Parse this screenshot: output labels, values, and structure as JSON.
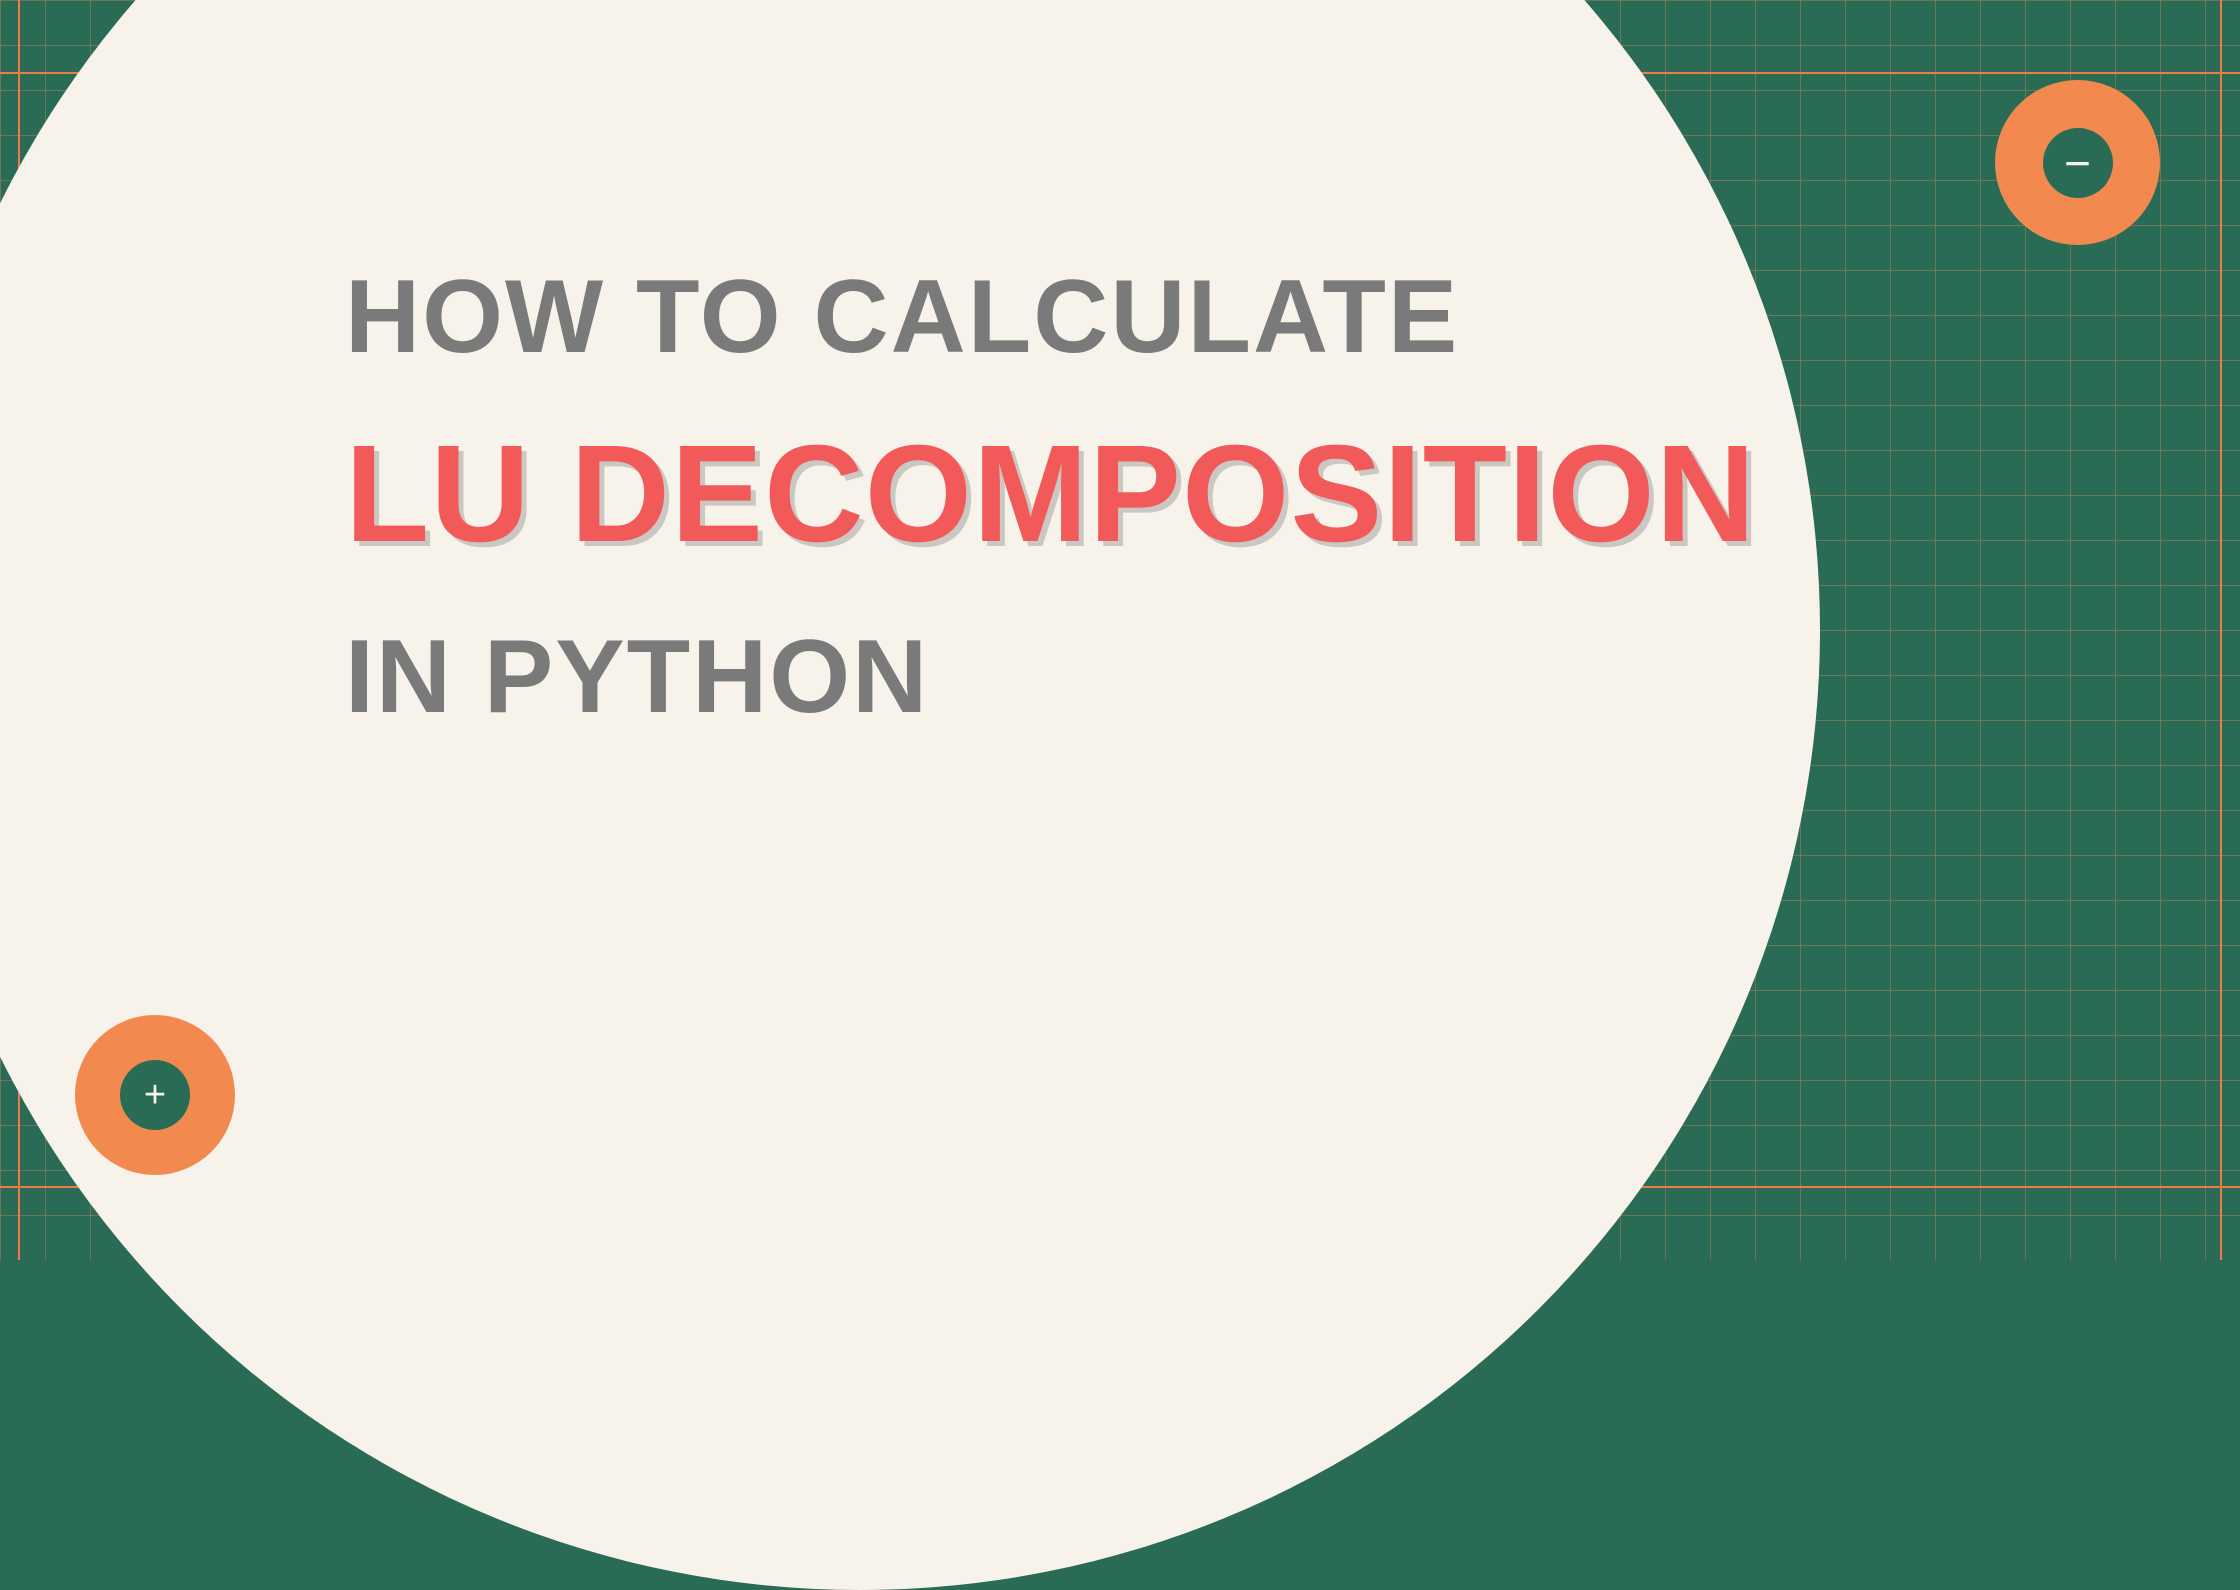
{
  "title_line1": "HOW TO CALCULATE",
  "title_line2": "LU DECOMPOSITION",
  "title_line3": "IN PYTHON",
  "decorations": {
    "top_right_symbol": "−",
    "bottom_left_symbol": "+"
  },
  "colors": {
    "background_green": "#2a6b55",
    "cream": "#f7f2ea",
    "orange": "#f28a4f",
    "orange_line": "#ef7b4a",
    "text_gray": "#7a7a7a",
    "text_coral": "#f25a5a"
  }
}
